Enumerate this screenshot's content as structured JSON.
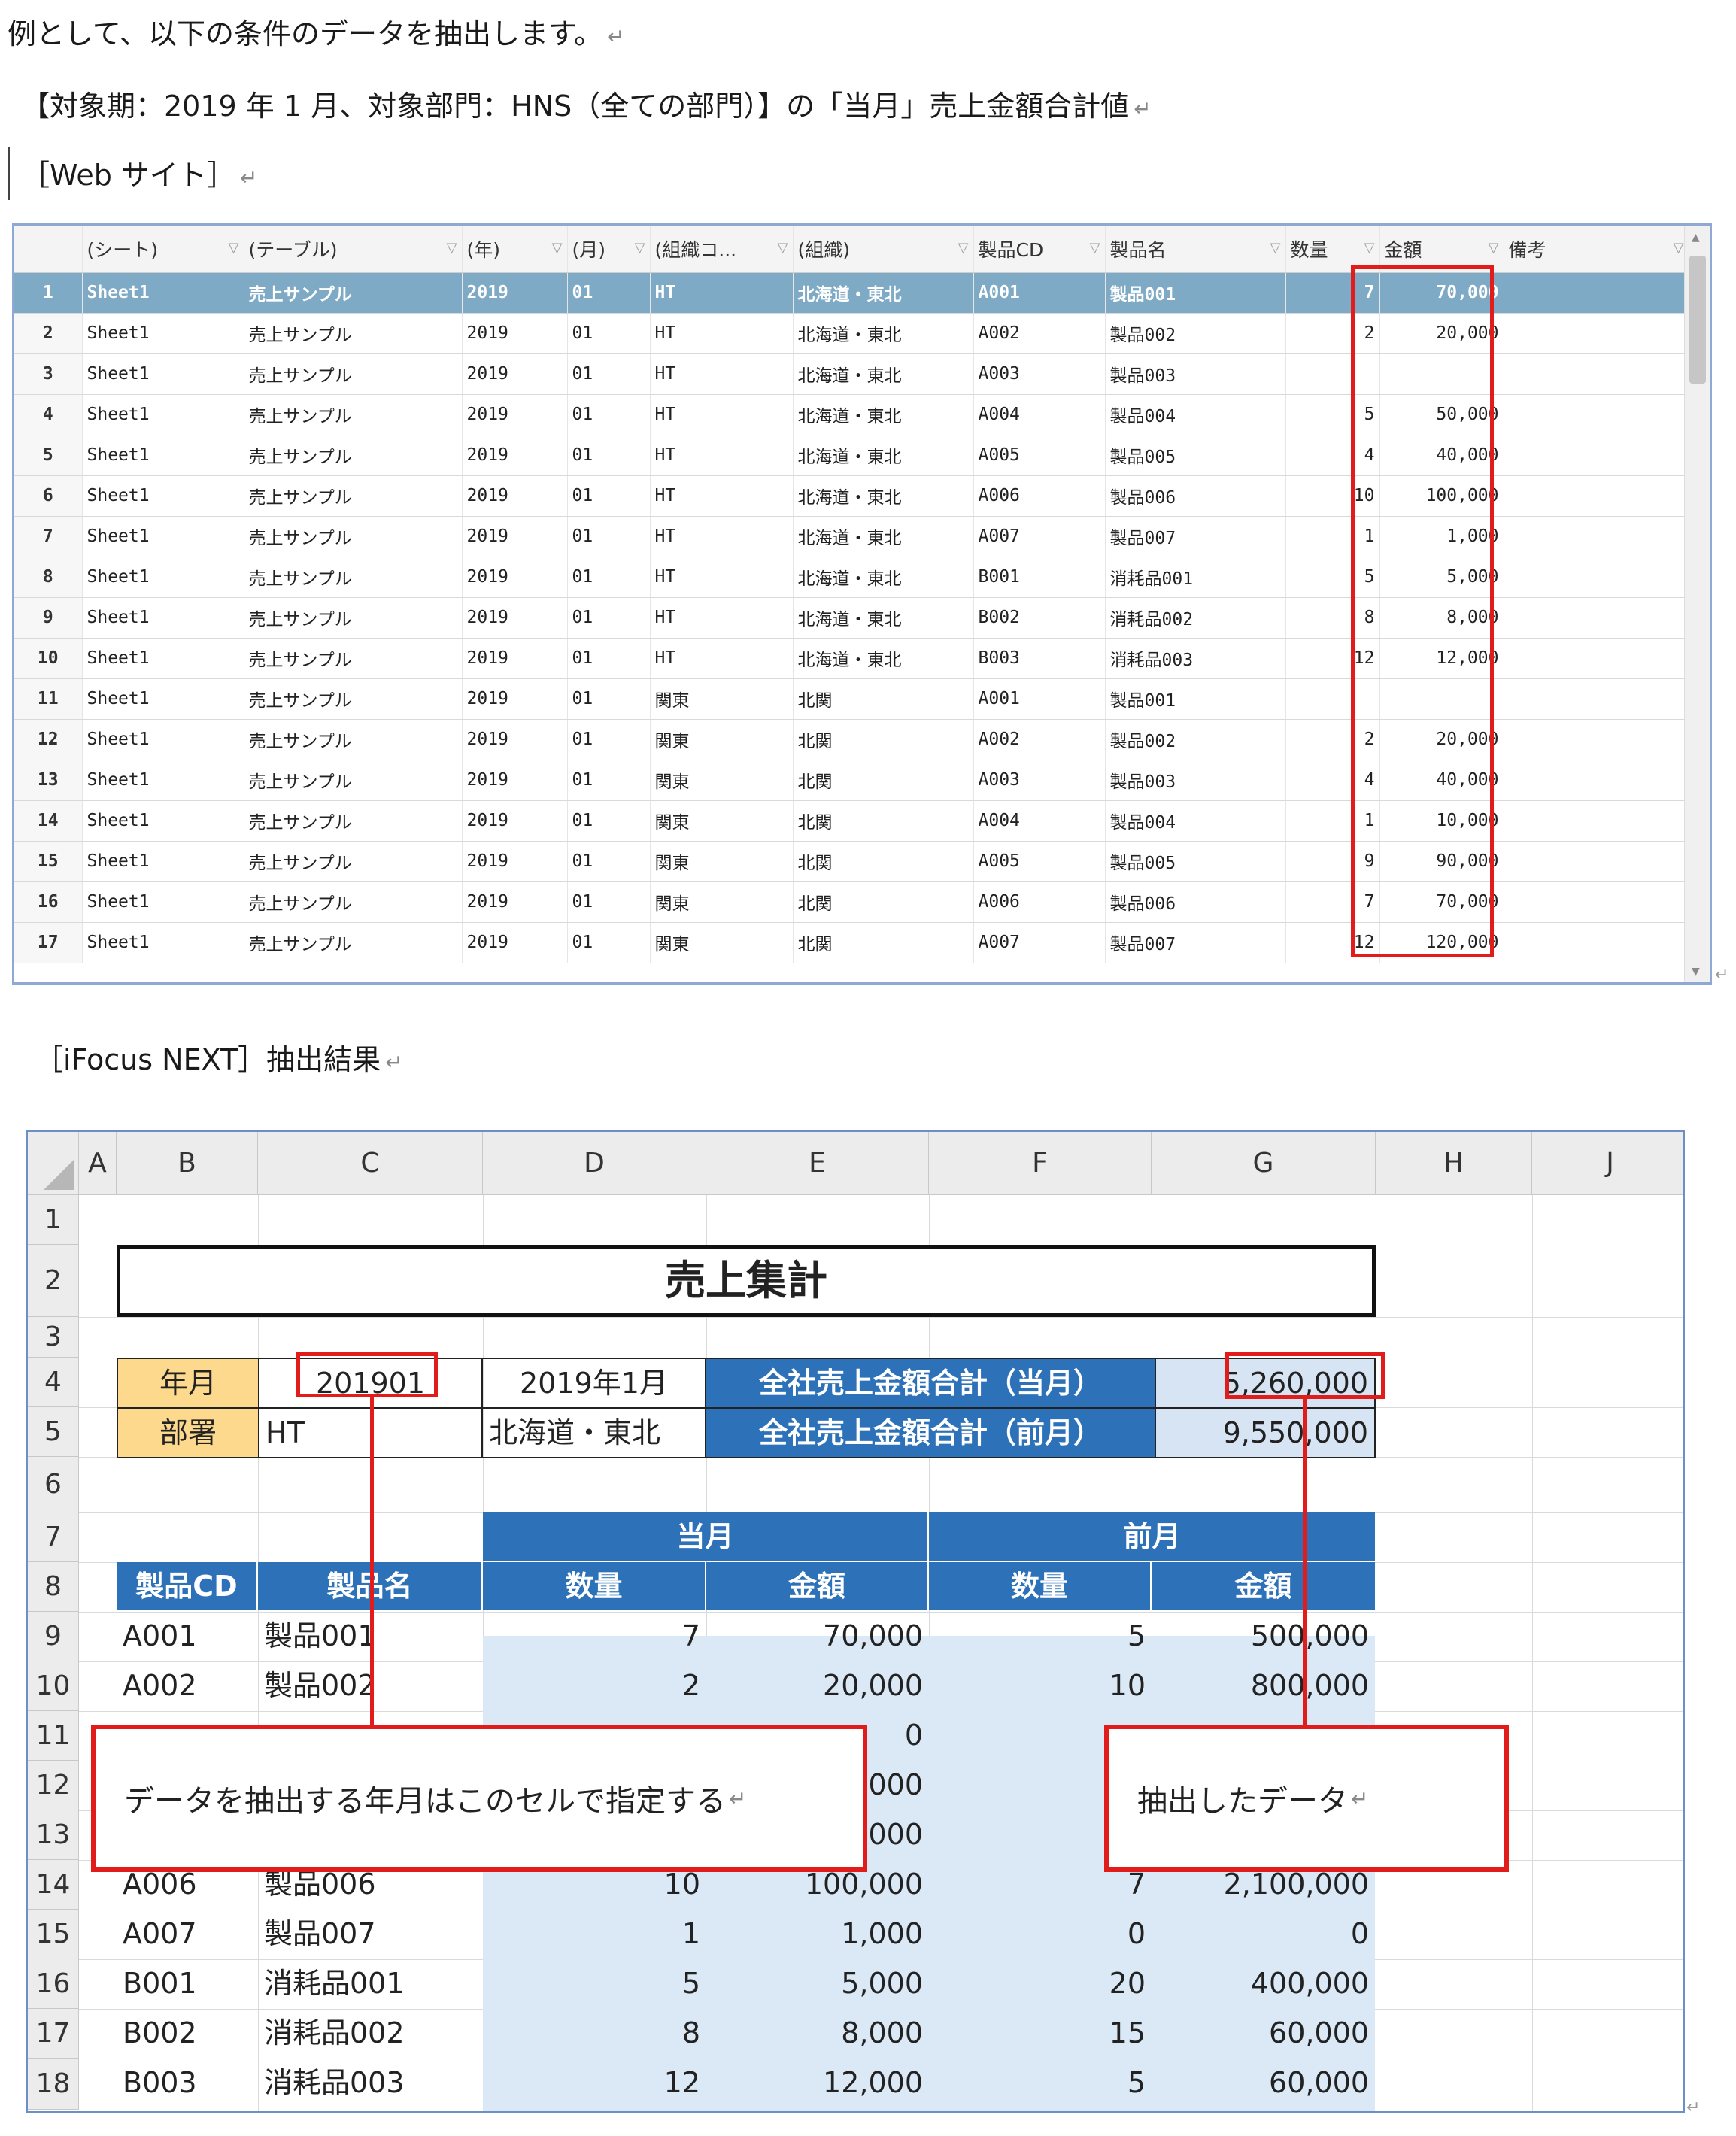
{
  "doc": {
    "line1": "例として、以下の条件のデータを抽出します。",
    "line2": "【対象期：2019 年 1 月、対象部門：HNS（全ての部門）】の「当月」売上金額合計値",
    "line3": "［Web サイト］",
    "line4": "［iFocus NEXT］抽出結果",
    "return_mark": "↵"
  },
  "web_grid": {
    "headers": [
      "(シート)",
      "(テーブル)",
      "(年)",
      "(月)",
      "(組織コ...",
      "(組織)",
      "製品CD",
      "製品名",
      "数量",
      "金額",
      "備考"
    ],
    "rows": [
      [
        "1",
        "Sheet1",
        "売上サンプル",
        "2019",
        "01",
        "HT",
        "北海道・東北",
        "A001",
        "製品001",
        "7",
        "70,000"
      ],
      [
        "2",
        "Sheet1",
        "売上サンプル",
        "2019",
        "01",
        "HT",
        "北海道・東北",
        "A002",
        "製品002",
        "2",
        "20,000"
      ],
      [
        "3",
        "Sheet1",
        "売上サンプル",
        "2019",
        "01",
        "HT",
        "北海道・東北",
        "A003",
        "製品003",
        "",
        ""
      ],
      [
        "4",
        "Sheet1",
        "売上サンプル",
        "2019",
        "01",
        "HT",
        "北海道・東北",
        "A004",
        "製品004",
        "5",
        "50,000"
      ],
      [
        "5",
        "Sheet1",
        "売上サンプル",
        "2019",
        "01",
        "HT",
        "北海道・東北",
        "A005",
        "製品005",
        "4",
        "40,000"
      ],
      [
        "6",
        "Sheet1",
        "売上サンプル",
        "2019",
        "01",
        "HT",
        "北海道・東北",
        "A006",
        "製品006",
        "10",
        "100,000"
      ],
      [
        "7",
        "Sheet1",
        "売上サンプル",
        "2019",
        "01",
        "HT",
        "北海道・東北",
        "A007",
        "製品007",
        "1",
        "1,000"
      ],
      [
        "8",
        "Sheet1",
        "売上サンプル",
        "2019",
        "01",
        "HT",
        "北海道・東北",
        "B001",
        "消耗品001",
        "5",
        "5,000"
      ],
      [
        "9",
        "Sheet1",
        "売上サンプル",
        "2019",
        "01",
        "HT",
        "北海道・東北",
        "B002",
        "消耗品002",
        "8",
        "8,000"
      ],
      [
        "10",
        "Sheet1",
        "売上サンプル",
        "2019",
        "01",
        "HT",
        "北海道・東北",
        "B003",
        "消耗品003",
        "12",
        "12,000"
      ],
      [
        "11",
        "Sheet1",
        "売上サンプル",
        "2019",
        "01",
        "関東",
        "北関",
        "A001",
        "製品001",
        "",
        ""
      ],
      [
        "12",
        "Sheet1",
        "売上サンプル",
        "2019",
        "01",
        "関東",
        "北関",
        "A002",
        "製品002",
        "2",
        "20,000"
      ],
      [
        "13",
        "Sheet1",
        "売上サンプル",
        "2019",
        "01",
        "関東",
        "北関",
        "A003",
        "製品003",
        "4",
        "40,000"
      ],
      [
        "14",
        "Sheet1",
        "売上サンプル",
        "2019",
        "01",
        "関東",
        "北関",
        "A004",
        "製品004",
        "1",
        "10,000"
      ],
      [
        "15",
        "Sheet1",
        "売上サンプル",
        "2019",
        "01",
        "関東",
        "北関",
        "A005",
        "製品005",
        "9",
        "90,000"
      ],
      [
        "16",
        "Sheet1",
        "売上サンプル",
        "2019",
        "01",
        "関東",
        "北関",
        "A006",
        "製品006",
        "7",
        "70,000"
      ],
      [
        "17",
        "Sheet1",
        "売上サンプル",
        "2019",
        "01",
        "関東",
        "北関",
        "A007",
        "製品007",
        "12",
        "120,000"
      ]
    ]
  },
  "excel": {
    "columns": [
      "A",
      "B",
      "C",
      "D",
      "E",
      "F",
      "G",
      "H",
      "J"
    ],
    "rows": [
      "1",
      "2",
      "3",
      "4",
      "5",
      "6",
      "7",
      "8",
      "9",
      "10",
      "11",
      "12",
      "13",
      "14",
      "15",
      "16",
      "17",
      "18"
    ],
    "title": "売上集計",
    "label_yearmonth": "年月",
    "value_yearmonth": "201901",
    "value_yearmonth_text": "2019年1月",
    "label_dept": "部署",
    "value_dept": "HT",
    "value_dept_name": "北海道・東北",
    "total_current_label": "全社売上金額合計（当月）",
    "total_current_value": "5,260,000",
    "total_prev_label": "全社売上金額合計（前月）",
    "total_prev_value": "9,550,000",
    "header_current": "当月",
    "header_prev": "前月",
    "col_code": "製品CD",
    "col_name": "製品名",
    "col_qty": "数量",
    "col_amount": "金額",
    "data_rows": [
      {
        "code": "A001",
        "name": "製品001",
        "cur_qty": "7",
        "cur_amt": "70,000",
        "prev_qty": "5",
        "prev_amt": "500,000"
      },
      {
        "code": "A002",
        "name": "製品002",
        "cur_qty": "2",
        "cur_amt": "20,000",
        "prev_qty": "10",
        "prev_amt": "800,000"
      },
      {
        "code": "",
        "name": "",
        "cur_qty": "",
        "cur_amt": "0",
        "prev_qty": "",
        "prev_amt": ""
      },
      {
        "code": "",
        "name": "",
        "cur_qty": "",
        "cur_amt": ",000",
        "prev_qty": "",
        "prev_amt": ""
      },
      {
        "code": "",
        "name": "",
        "cur_qty": "",
        "cur_amt": ",000",
        "prev_qty": "",
        "prev_amt": ""
      },
      {
        "code": "A006",
        "name": "製品006",
        "cur_qty": "10",
        "cur_amt": "100,000",
        "prev_qty": "7",
        "prev_amt": "2,100,000"
      },
      {
        "code": "A007",
        "name": "製品007",
        "cur_qty": "1",
        "cur_amt": "1,000",
        "prev_qty": "0",
        "prev_amt": "0"
      },
      {
        "code": "B001",
        "name": "消耗品001",
        "cur_qty": "5",
        "cur_amt": "5,000",
        "prev_qty": "20",
        "prev_amt": "400,000"
      },
      {
        "code": "B002",
        "name": "消耗品002",
        "cur_qty": "8",
        "cur_amt": "8,000",
        "prev_qty": "15",
        "prev_amt": "60,000"
      },
      {
        "code": "B003",
        "name": "消耗品003",
        "cur_qty": "12",
        "cur_amt": "12,000",
        "prev_qty": "5",
        "prev_amt": "60,000"
      }
    ],
    "callout_left": "データを抽出する年月はこのセルで指定する",
    "callout_right": "抽出したデータ"
  },
  "colors": {
    "highlight_red": "#e21b1b",
    "header_blue": "#2d71b8",
    "label_yellow": "#fcd98c",
    "data_lightblue": "#dbe9f7",
    "web_selected_row": "#7eaac5"
  }
}
